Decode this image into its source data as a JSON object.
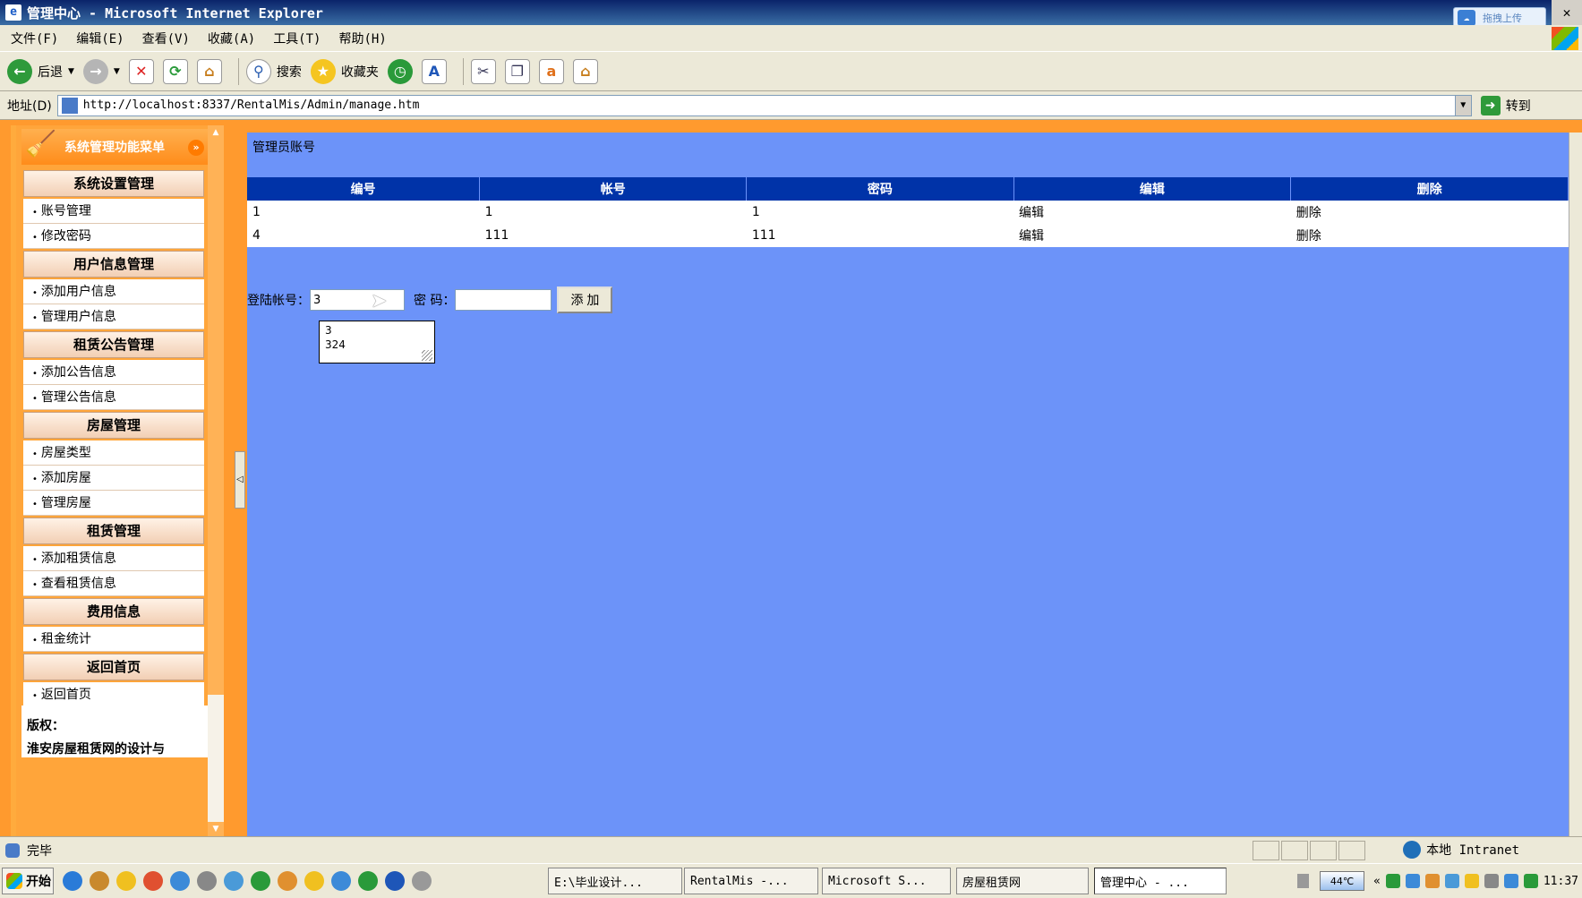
{
  "window": {
    "title": "管理中心 - Microsoft Internet Explorer",
    "upload_label": "拖拽上传"
  },
  "menubar": [
    "文件(F)",
    "编辑(E)",
    "查看(V)",
    "收藏(A)",
    "工具(T)",
    "帮助(H)"
  ],
  "toolbar": {
    "back_label": "后退",
    "search_label": "搜索",
    "favorites_label": "收藏夹"
  },
  "address": {
    "label": "地址(D)",
    "url": "http://localhost:8337/RentalMis/Admin/manage.htm",
    "go_label": "转到"
  },
  "sidebar": {
    "header": "系统管理功能菜单",
    "sections": [
      {
        "title": "系统设置管理",
        "items": [
          "账号管理",
          "修改密码"
        ]
      },
      {
        "title": "用户信息管理",
        "items": [
          "添加用户信息",
          "管理用户信息"
        ]
      },
      {
        "title": "租赁公告管理",
        "items": [
          "添加公告信息",
          "管理公告信息"
        ]
      },
      {
        "title": "房屋管理",
        "items": [
          "房屋类型",
          "添加房屋",
          "管理房屋"
        ]
      },
      {
        "title": "租赁管理",
        "items": [
          "添加租赁信息",
          "查看租赁信息"
        ]
      },
      {
        "title": "费用信息",
        "items": [
          "租金统计"
        ]
      },
      {
        "title": "返回首页",
        "items": [
          "返回首页"
        ]
      }
    ],
    "copyright_label": "版权：",
    "copyright_text": "淮安房屋租赁网的设计与"
  },
  "main": {
    "title": "管理员账号",
    "columns": [
      "编号",
      "帐号",
      "密码",
      "编辑",
      "删除"
    ],
    "rows": [
      [
        "1",
        "1",
        "1",
        "编辑",
        "删除"
      ],
      [
        "4",
        "111",
        "111",
        "编辑",
        "删除"
      ]
    ],
    "form": {
      "account_label": "登陆帐号：",
      "account_value": "3",
      "password_label": "密 码：",
      "password_value": "",
      "add_button": "添 加"
    },
    "autocomplete": [
      "3",
      "324"
    ]
  },
  "status": {
    "text": "完毕",
    "zone": "本地 Intranet"
  },
  "taskbar": {
    "start": "开始",
    "tasks": [
      "E:\\毕业设计...",
      "RentalMis -...",
      "Microsoft S...",
      "房屋租赁网",
      "管理中心 - ..."
    ],
    "temperature": "44℃",
    "clock": "11:37"
  }
}
